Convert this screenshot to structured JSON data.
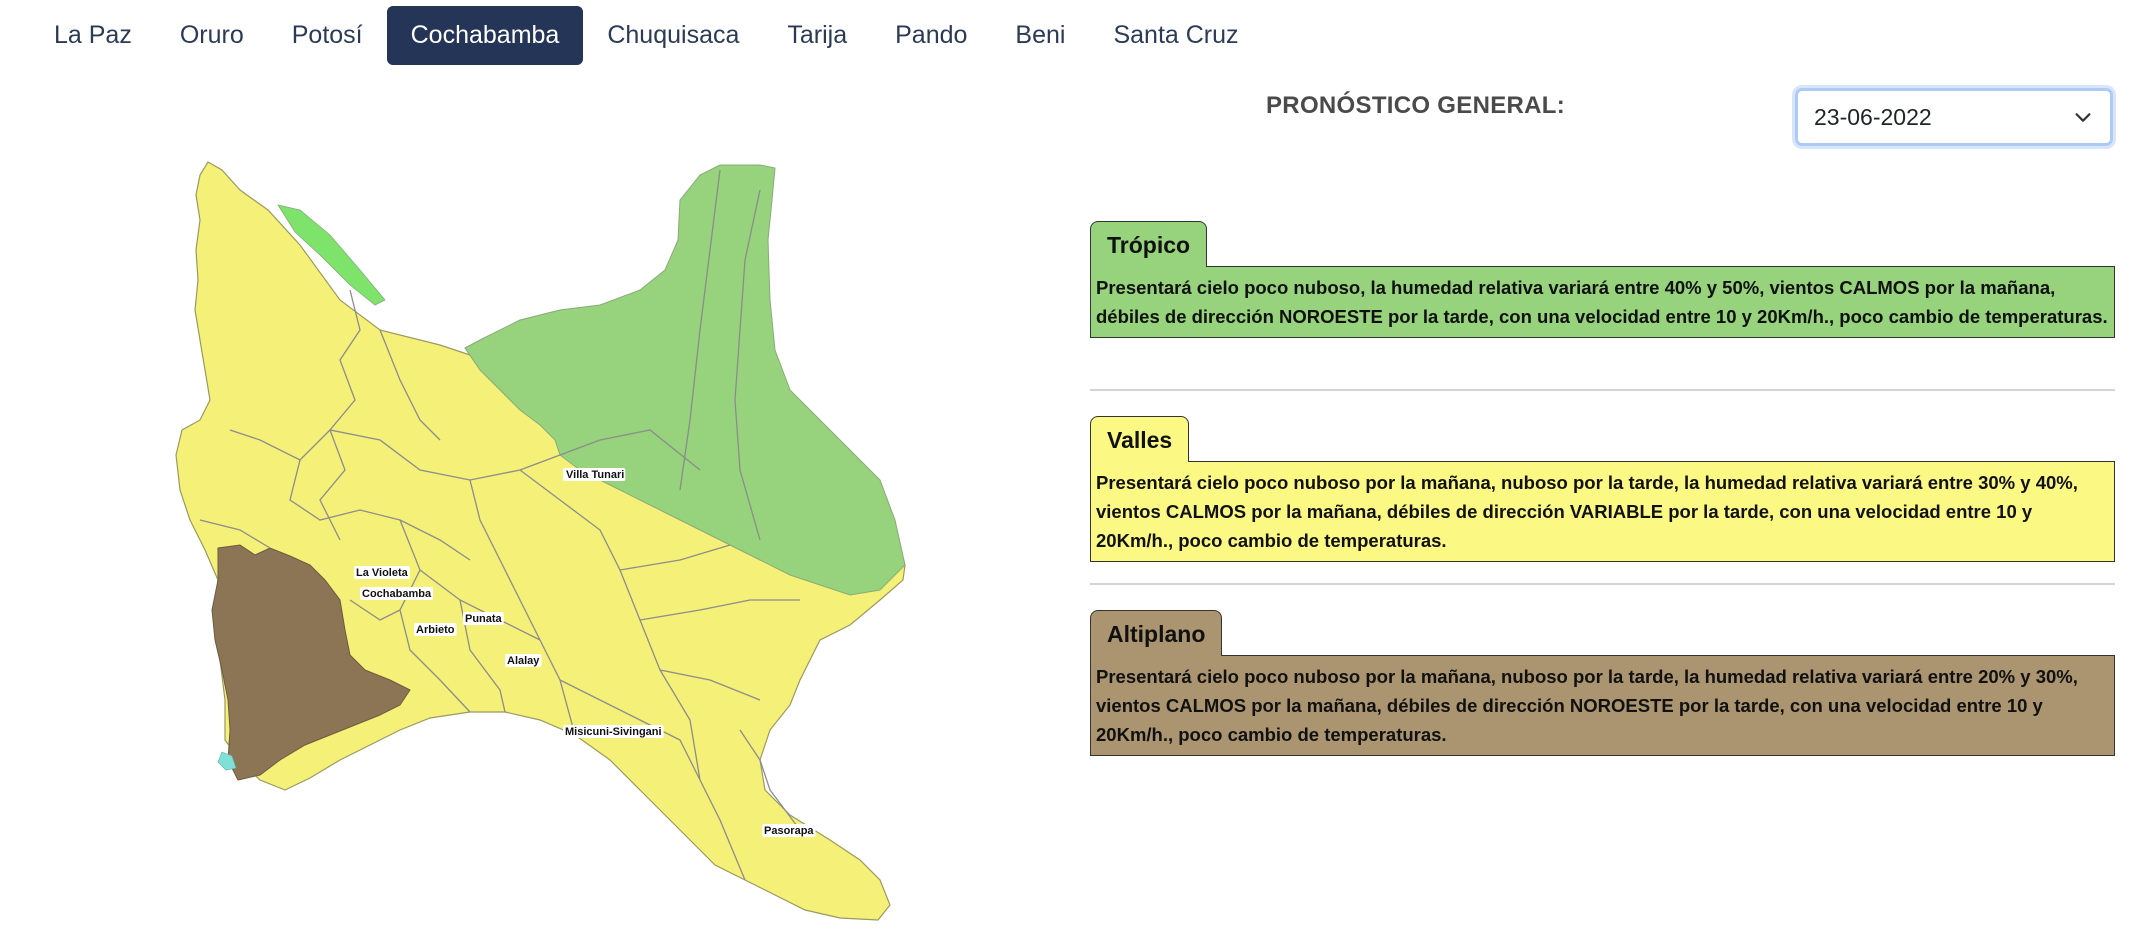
{
  "tabs": [
    "La Paz",
    "Oruro",
    "Potosí",
    "Cochabamba",
    "Chuquisaca",
    "Tarija",
    "Pando",
    "Beni",
    "Santa Cruz"
  ],
  "active_tab": "Cochabamba",
  "general": {
    "title": "PRONÓSTICO GENERAL:",
    "date_value": "23-06-2022"
  },
  "map": {
    "labels": [
      "Villa Tunari",
      "La Violeta",
      "Cochabamba",
      "Arbieto",
      "Punata",
      "Alalay",
      "Misicuni-Sivingani",
      "Pasorapa"
    ],
    "colors": {
      "tropico": "#96d37c",
      "valles": "#f5f078",
      "altiplano": "#8c7554",
      "lake": "#7fe0d8"
    }
  },
  "zones": [
    {
      "name": "Trópico",
      "color": "#96d37c",
      "text": "Presentará cielo poco nuboso, la humedad relativa variará entre 40% y 50%, vientos CALMOS por la mañana, débiles de dirección NOROESTE por la tarde, con una velocidad entre 10 y 20Km/h., poco cambio de temperaturas."
    },
    {
      "name": "Valles",
      "color": "#fbf983",
      "text": "Presentará cielo poco nuboso por la mañana, nuboso por la tarde, la humedad relativa variará entre 30% y 40%, vientos CALMOS por la mañana, débiles de dirección VARIABLE por la tarde, con una velocidad entre 10 y 20Km/h., poco cambio de temperaturas."
    },
    {
      "name": "Altiplano",
      "color": "#ab9570",
      "text": "Presentará cielo poco nuboso por la mañana, nuboso por la tarde, la humedad relativa variará entre 20% y 30%, vientos CALMOS por la mañana, débiles de dirección NOROESTE por la tarde, con una velocidad entre 10 y 20Km/h., poco cambio de temperaturas."
    }
  ]
}
